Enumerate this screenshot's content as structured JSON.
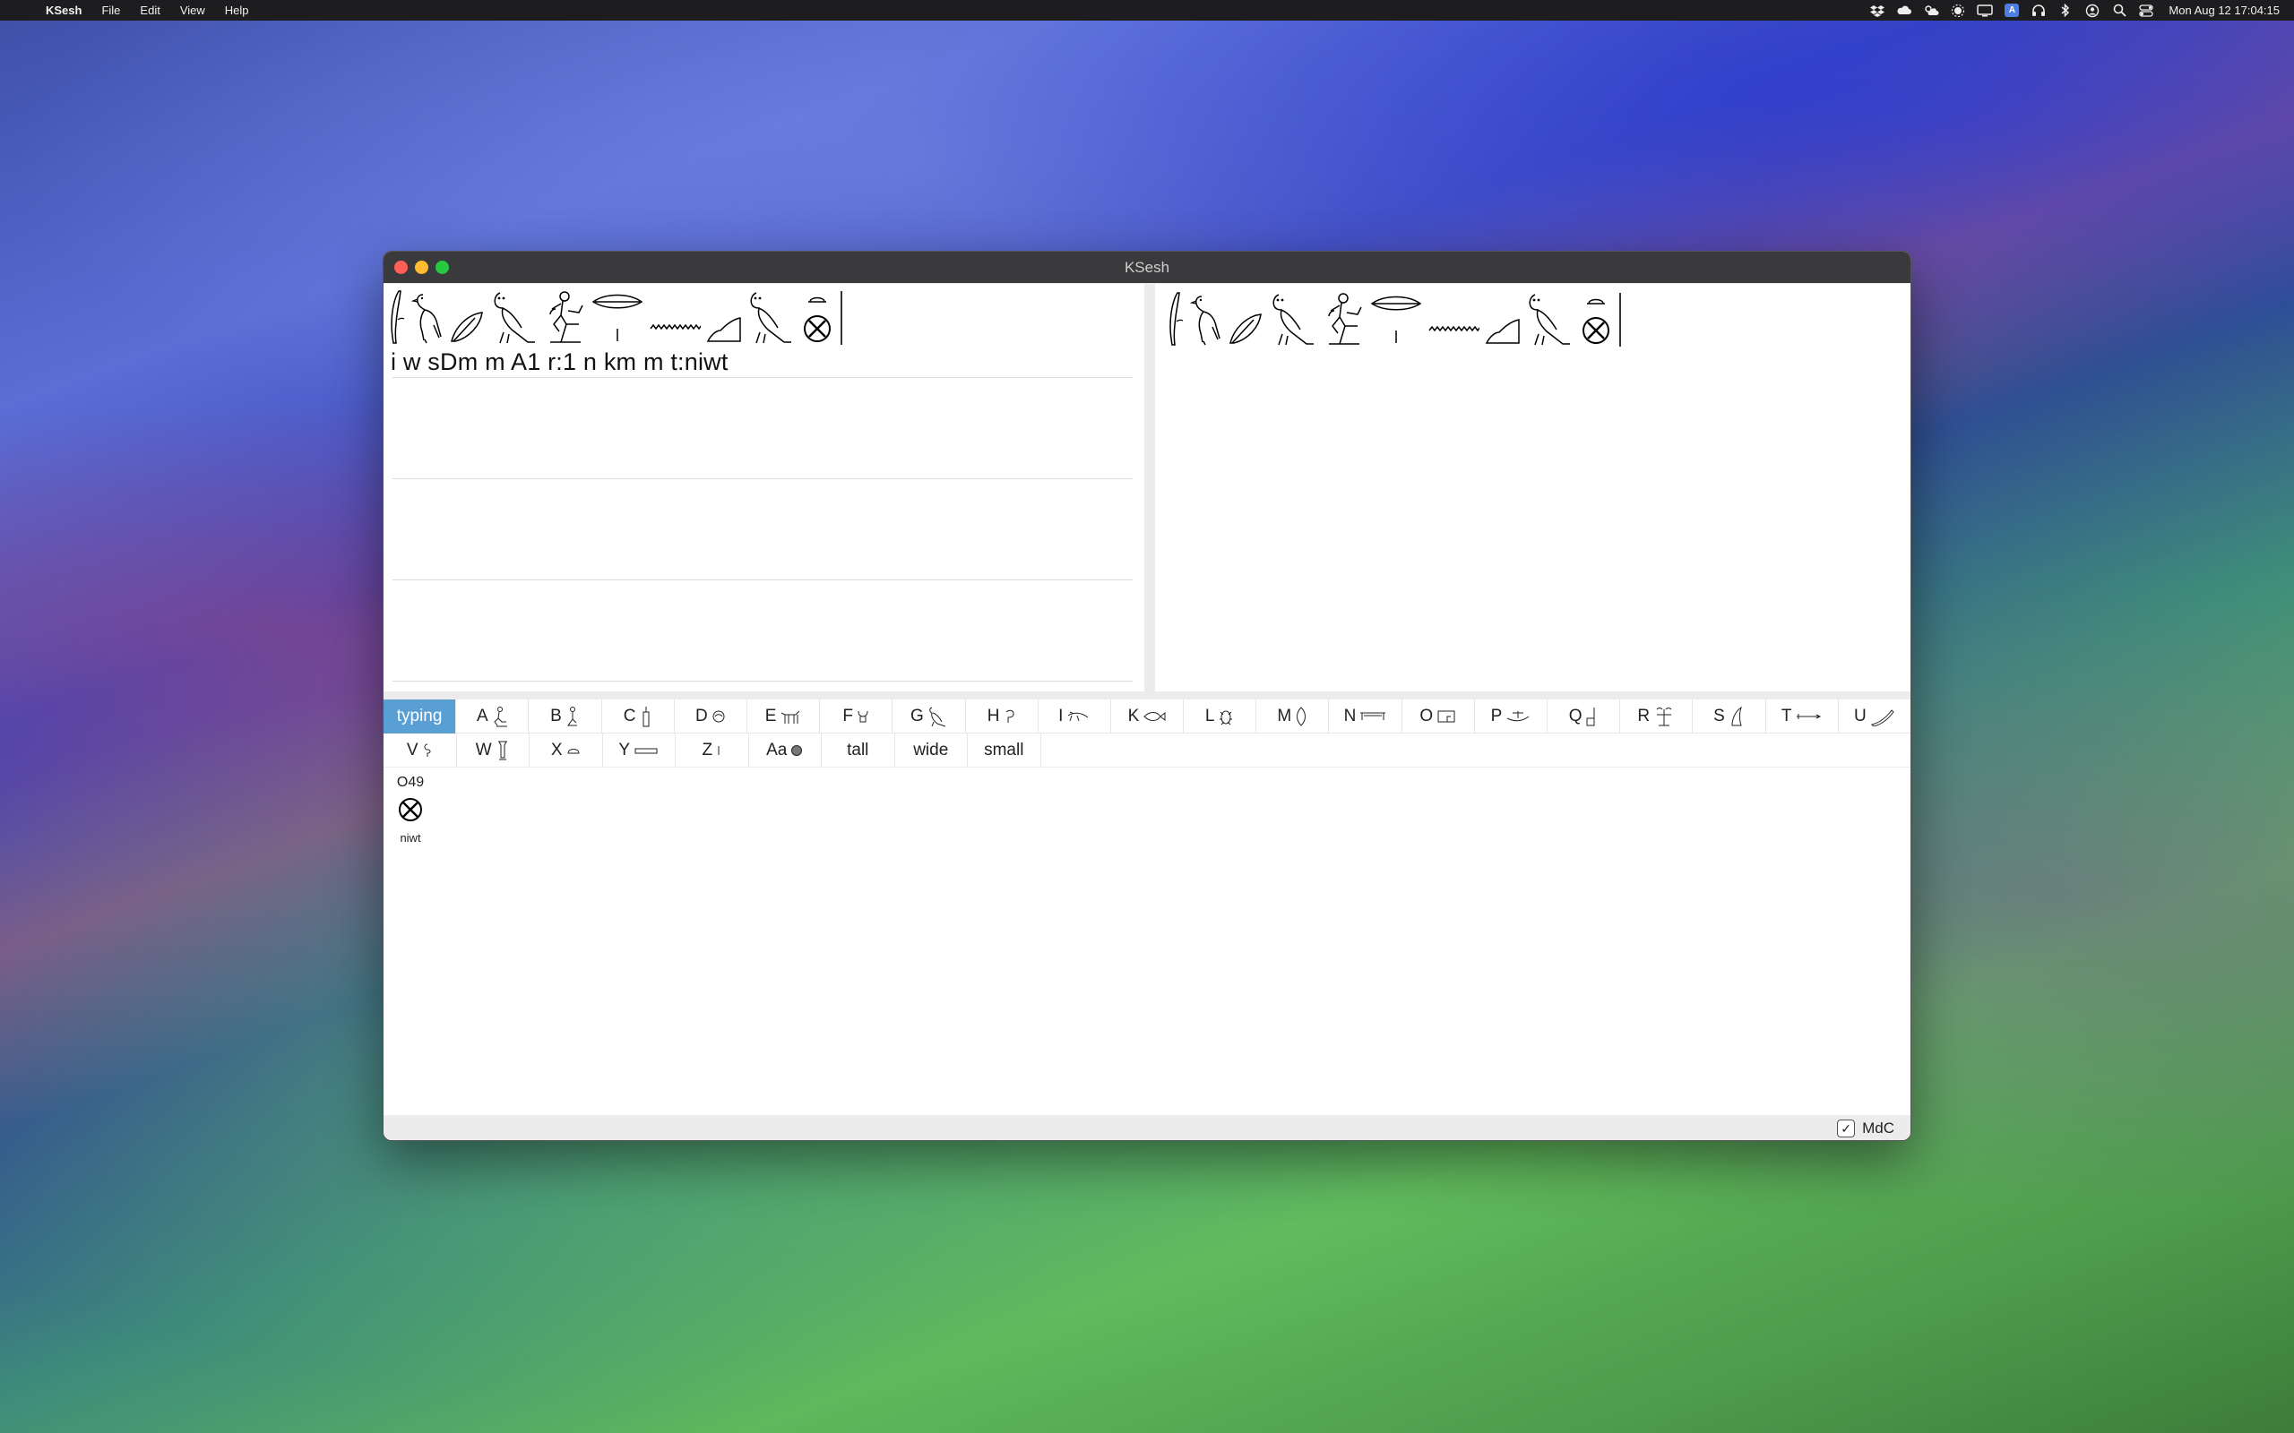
{
  "menubar": {
    "app_name": "KSesh",
    "menus": [
      "File",
      "Edit",
      "View",
      "Help"
    ],
    "tray_icons": [
      "dropbox-icon",
      "cloud-icon",
      "weather-icon",
      "brightness-icon",
      "display-icon",
      "input-source-icon",
      "headphones-icon",
      "bluetooth-icon",
      "user-icon",
      "search-icon",
      "control-center-icon"
    ],
    "input_source_label": "A",
    "clock": "Mon Aug 12  17:04:15"
  },
  "window": {
    "title": "KSesh"
  },
  "editor": {
    "mdc_text": "i w sDm m A1 r:1 n km m t:niwt",
    "glyphs": [
      "reed-leaf",
      "quail-chick",
      "feather",
      "owl",
      "seated-man",
      "mouth-over-stroke",
      "water",
      "bread-loaf",
      "owl",
      "city-sign"
    ]
  },
  "palette": {
    "tabs_row1": [
      {
        "label": "typing",
        "icon": ""
      },
      {
        "label": "A",
        "icon": "seated-man-icon"
      },
      {
        "label": "B",
        "icon": "seated-woman-icon"
      },
      {
        "label": "C",
        "icon": "deity-icon"
      },
      {
        "label": "D",
        "icon": "eye-icon"
      },
      {
        "label": "E",
        "icon": "mammal-icon"
      },
      {
        "label": "F",
        "icon": "animal-part-icon"
      },
      {
        "label": "G",
        "icon": "bird-icon"
      },
      {
        "label": "H",
        "icon": "bird-part-icon"
      },
      {
        "label": "I",
        "icon": "reptile-icon"
      },
      {
        "label": "K",
        "icon": "fish-icon"
      },
      {
        "label": "L",
        "icon": "insect-icon"
      },
      {
        "label": "M",
        "icon": "plant-icon"
      },
      {
        "label": "N",
        "icon": "sky-icon"
      },
      {
        "label": "O",
        "icon": "building-icon"
      },
      {
        "label": "P",
        "icon": "boat-icon"
      },
      {
        "label": "Q",
        "icon": "furniture-icon"
      },
      {
        "label": "R",
        "icon": "temple-icon"
      },
      {
        "label": "S",
        "icon": "crown-icon"
      },
      {
        "label": "T",
        "icon": "weapon-icon"
      },
      {
        "label": "U",
        "icon": "tool-icon"
      }
    ],
    "tabs_row2": [
      {
        "label": "V",
        "icon": "rope-icon"
      },
      {
        "label": "W",
        "icon": "vessel-icon"
      },
      {
        "label": "X",
        "icon": "loaf-icon"
      },
      {
        "label": "Y",
        "icon": "writing-icon"
      },
      {
        "label": "Z",
        "icon": "stroke-icon"
      },
      {
        "label": "Aa",
        "icon": "unclassified-icon"
      },
      {
        "label": "tall",
        "icon": ""
      },
      {
        "label": "wide",
        "icon": ""
      },
      {
        "label": "small",
        "icon": ""
      }
    ],
    "selected_sign": {
      "code": "O49",
      "name": "niwt"
    }
  },
  "status": {
    "mdc_checkbox_label": "MdC",
    "mdc_checked": true
  }
}
